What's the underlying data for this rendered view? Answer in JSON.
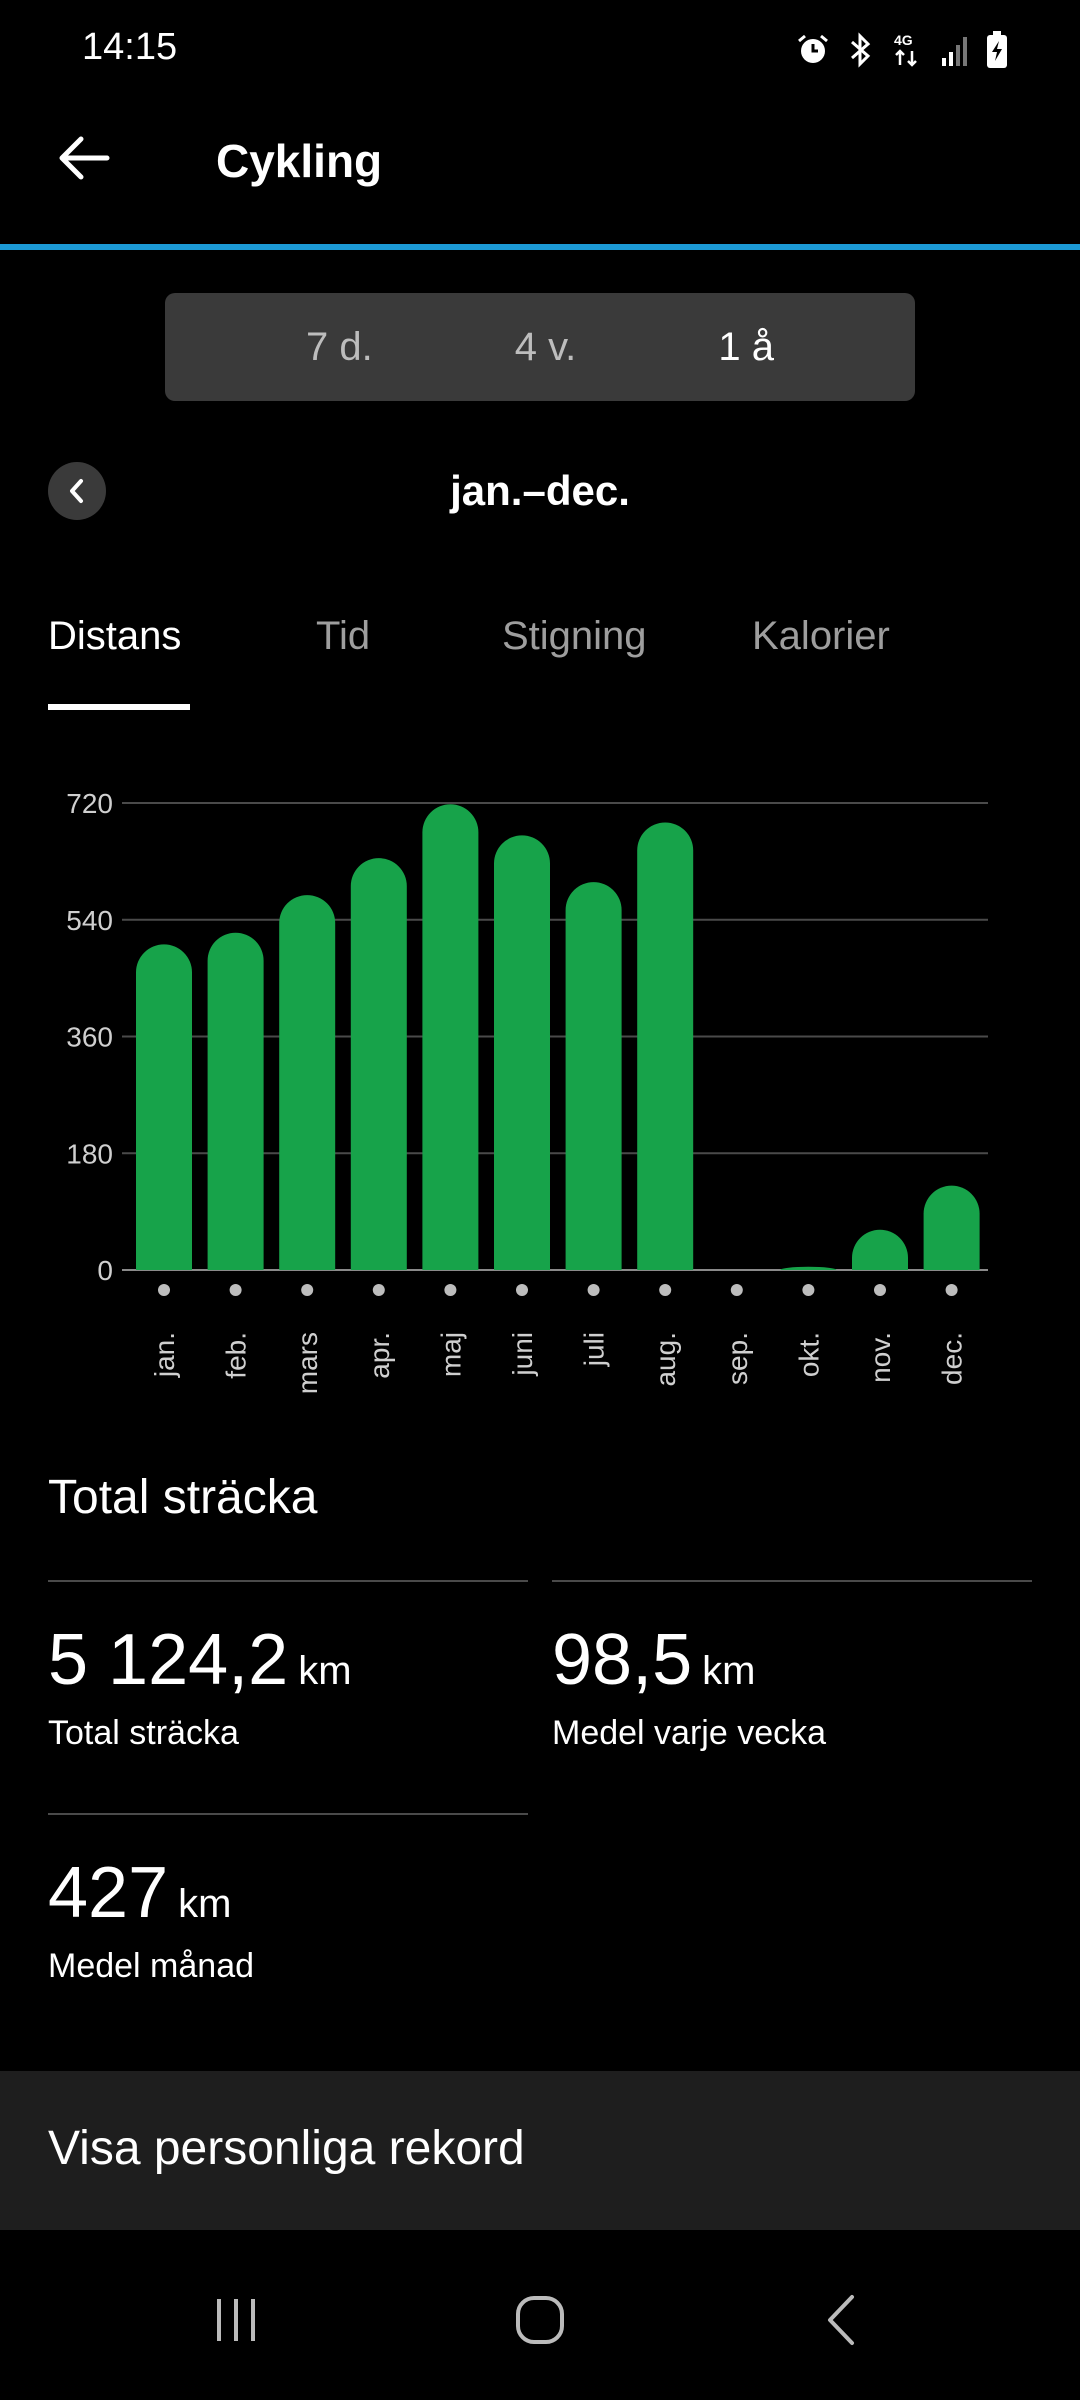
{
  "status_bar": {
    "time": "14:15",
    "network": "4G",
    "icons": [
      "alarm-icon",
      "bluetooth-icon",
      "network-4g-icon",
      "signal-icon",
      "battery-charging-icon"
    ]
  },
  "header": {
    "title": "Cykling",
    "back_icon": "arrow-left-icon",
    "accent_color": "#1c9ad6"
  },
  "range_selector": {
    "options": [
      "7 d.",
      "4 v.",
      "1 å"
    ],
    "selected_index": 2
  },
  "period": {
    "label": "jan.–dec.",
    "prev_icon": "chevron-left-icon"
  },
  "metric_tabs": {
    "items": [
      "Distans",
      "Tid",
      "Stigning",
      "Kalorier"
    ],
    "selected_index": 0
  },
  "chart_data": {
    "type": "bar",
    "categories": [
      "jan.",
      "feb.",
      "mars",
      "apr.",
      "maj",
      "juni",
      "juli",
      "aug.",
      "sep.",
      "okt.",
      "nov.",
      "dec."
    ],
    "values": [
      502,
      520,
      578,
      635,
      718,
      670,
      598,
      690,
      0,
      5,
      62,
      130
    ],
    "ylim": [
      0,
      720
    ],
    "yticks": [
      "0",
      "180",
      "360",
      "540",
      "720"
    ],
    "ytick_values": [
      0,
      180,
      360,
      540,
      720
    ],
    "grid": true,
    "bar_color": "#17a34a"
  },
  "summary": {
    "title": "Total sträcka",
    "stats": [
      {
        "value": "5 124,2",
        "unit": "km",
        "label": "Total sträcka"
      },
      {
        "value": "98,5",
        "unit": "km",
        "label": "Medel varje vecka"
      },
      {
        "value": "427",
        "unit": "km",
        "label": "Medel månad"
      }
    ]
  },
  "records": {
    "label": "Visa personliga rekord"
  },
  "nav_bar": {
    "icons": [
      "recent-apps-icon",
      "home-icon",
      "back-icon"
    ]
  }
}
